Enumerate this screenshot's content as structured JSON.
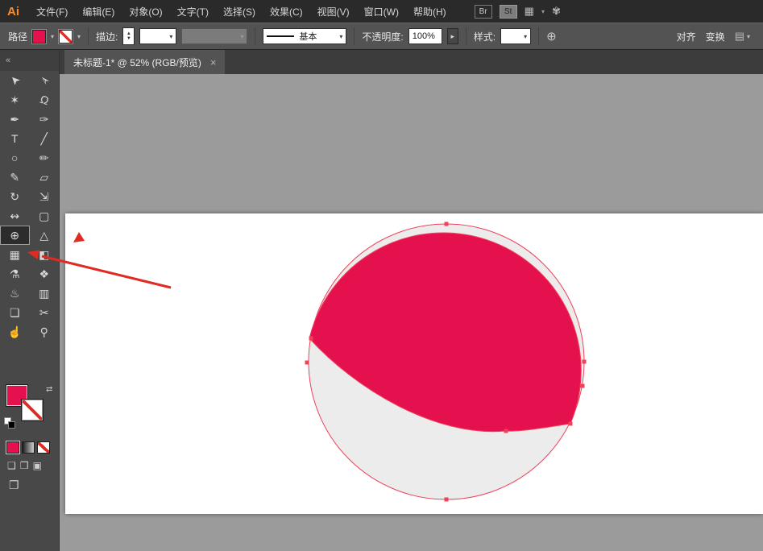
{
  "menu_bar": {
    "logo": "Ai",
    "items": [
      {
        "label": "文件(F)"
      },
      {
        "label": "编辑(E)"
      },
      {
        "label": "对象(O)"
      },
      {
        "label": "文字(T)"
      },
      {
        "label": "选择(S)"
      },
      {
        "label": "效果(C)"
      },
      {
        "label": "视图(V)"
      },
      {
        "label": "窗口(W)"
      },
      {
        "label": "帮助(H)"
      }
    ],
    "br_badge": "Br",
    "st_badge": "St"
  },
  "control_bar": {
    "path_label": "路径",
    "stroke_label": "描边:",
    "line_style_value": "基本",
    "opacity_label": "不透明度:",
    "opacity_value": "100%",
    "style_label": "样式:",
    "align_label": "对齐",
    "transform_label": "变换"
  },
  "tab": {
    "title": "未标题-1* @ 52% (RGB/预览)"
  },
  "document": {
    "zoom": "52%",
    "color_mode": "RGB/预览"
  },
  "toolbar": {
    "active_tool": "shape-builder-tool",
    "tools": [
      {
        "name": "selection-tool",
        "glyph": "➤"
      },
      {
        "name": "direct-selection-tool",
        "glyph": "➢"
      },
      {
        "name": "magic-wand-tool",
        "glyph": "✶"
      },
      {
        "name": "lasso-tool",
        "glyph": "Ω"
      },
      {
        "name": "pen-tool",
        "glyph": "✒"
      },
      {
        "name": "curvature-tool",
        "glyph": "✑"
      },
      {
        "name": "type-tool",
        "glyph": "T"
      },
      {
        "name": "line-segment-tool",
        "glyph": "╱"
      },
      {
        "name": "ellipse-tool",
        "glyph": "○"
      },
      {
        "name": "paintbrush-tool",
        "glyph": "✏"
      },
      {
        "name": "pencil-tool",
        "glyph": "✎"
      },
      {
        "name": "eraser-tool",
        "glyph": "▱"
      },
      {
        "name": "rotate-tool",
        "glyph": "↻"
      },
      {
        "name": "scale-tool",
        "glyph": "⇲"
      },
      {
        "name": "width-tool",
        "glyph": "↭"
      },
      {
        "name": "free-transform-tool",
        "glyph": "▢"
      },
      {
        "name": "shape-builder-tool",
        "glyph": "⊕"
      },
      {
        "name": "perspective-grid-tool",
        "glyph": "△"
      },
      {
        "name": "mesh-tool",
        "glyph": "▦"
      },
      {
        "name": "gradient-tool",
        "glyph": "◧"
      },
      {
        "name": "eyedropper-tool",
        "glyph": "⚗"
      },
      {
        "name": "blend-tool",
        "glyph": "❖"
      },
      {
        "name": "symbol-sprayer-tool",
        "glyph": "♨"
      },
      {
        "name": "column-graph-tool",
        "glyph": "▥"
      },
      {
        "name": "artboard-tool",
        "glyph": "❏"
      },
      {
        "name": "slice-tool",
        "glyph": "✂"
      },
      {
        "name": "hand-tool",
        "glyph": "☝"
      },
      {
        "name": "zoom-tool",
        "glyph": "⚲"
      }
    ]
  },
  "icons": {
    "caret": "▾",
    "stepper_up": "▲",
    "stepper_down": "▼",
    "swap": "⇄",
    "globe": "⊕",
    "close": "×",
    "collapse": "«",
    "panel": "▤",
    "forward": "▸",
    "workspace": "▦",
    "cs_live": "✾",
    "draw_normal": "❑",
    "draw_behind": "❒",
    "draw_inside": "▣",
    "screen_mode": "❐"
  },
  "colors": {
    "accent_crimson": "#e4114e",
    "shape_gray": "#ececec",
    "selection_red": "#f0415a",
    "annotation_red": "#df2b22"
  }
}
